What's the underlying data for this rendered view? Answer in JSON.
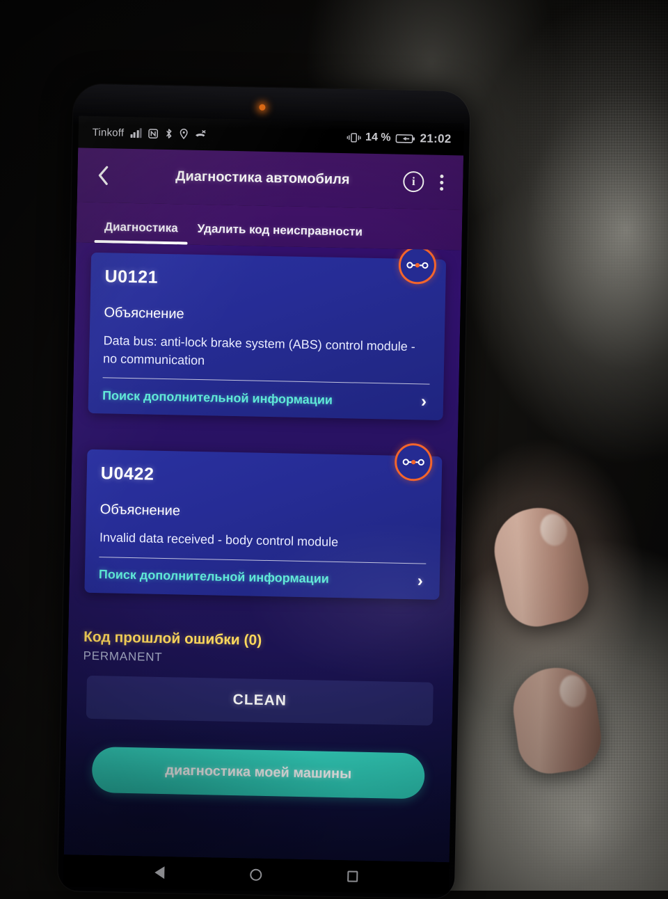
{
  "status_bar": {
    "carrier": "Tinkoff",
    "icons": [
      "signal-bars-icon",
      "nfc-icon",
      "bluetooth-icon",
      "location-icon",
      "missed-call-icon",
      "vibrate-icon",
      "battery-charging-icon"
    ],
    "battery_percent": "14 %",
    "clock": "21:02"
  },
  "header": {
    "back_icon": "chevron-left-icon",
    "title": "Диагностика автомобиля",
    "info_label": "i",
    "info_icon": "info-circle-icon",
    "menu_icon": "kebab-menu-icon"
  },
  "tabs": [
    {
      "label": "Диагностика",
      "active": true
    },
    {
      "label": "Удалить код неисправности",
      "active": false
    }
  ],
  "cards": [
    {
      "code": "U0121",
      "explain_label": "Объяснение",
      "explain_text": "Data bus: anti-lock brake system (ABS) control module - no communication",
      "link_label": "Поиск дополнительной информации",
      "link_chevron": "›",
      "badge_icon": "connector-link-icon"
    },
    {
      "code": "U0422",
      "explain_label": "Объяснение",
      "explain_text": "Invalid data received - body control module",
      "link_label": "Поиск дополнительной информации",
      "link_chevron": "›",
      "badge_icon": "connector-link-icon"
    }
  ],
  "past_errors": {
    "title": "Код прошлой ошибки (0)",
    "subtitle": "PERMANENT",
    "clean_button": "CLEAN"
  },
  "cta": {
    "label": "диагностика моей машины"
  },
  "nav_bar": {
    "back_icon": "nav-back-icon",
    "home_icon": "nav-home-icon",
    "recents_icon": "nav-recents-icon"
  },
  "colors": {
    "accent_teal": "#35d6c2",
    "link_teal": "#5fe9d7",
    "badge_orange": "#f4652b",
    "warning_yellow": "#ffd95c",
    "header_purple": "#3d1263",
    "card_blue": "#262c95"
  }
}
